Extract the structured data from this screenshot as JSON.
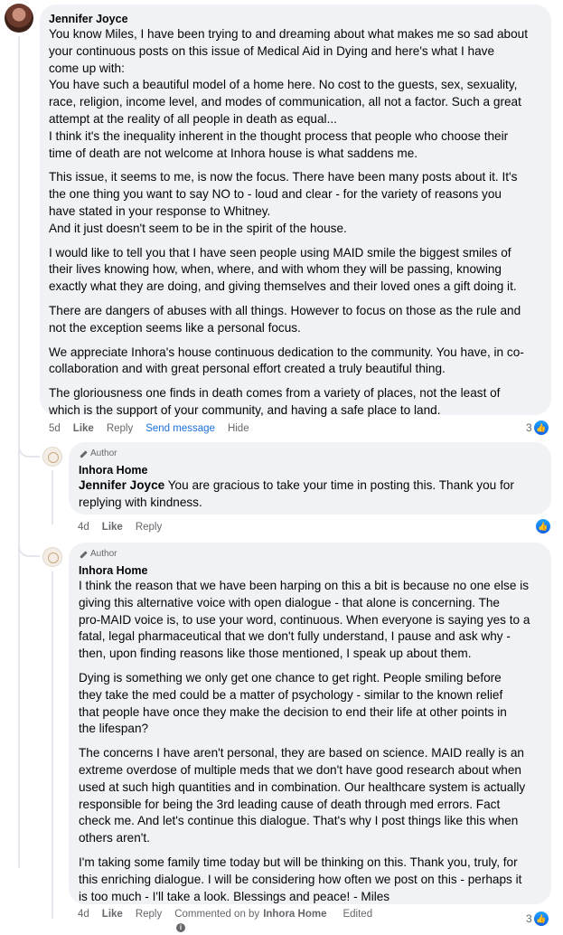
{
  "comment": {
    "author": "Jennifer Joyce",
    "paragraphs": [
      [
        "You know Miles, I have been trying to and dreaming about what makes me so sad about",
        "your continuous posts on this issue of Medical Aid in Dying and here's what I have",
        "come up with:",
        "You have such a beautiful model of a home here. No cost to the guests, sex, sexuality,",
        "race, religion, income level, and modes of communication, all not a factor. Such a great",
        "attempt at the reality of all people in death as equal...",
        "I think it's the inequality inherent in the thought process that people who choose their",
        "time of death are not welcome at Inhora house is what saddens me."
      ],
      [
        "This issue, it seems to me, is now the focus. There have been many posts about it. It's",
        "the one thing you want to say NO to - loud and clear - for the variety of reasons you",
        "have stated in your response to Whitney.",
        "And it just doesn't seem to be in the spirit of the house."
      ],
      [
        "I would like to tell you that I have seen people using MAID smile the biggest smiles of",
        "their lives knowing how, when, where, and with whom they will be passing, knowing",
        "exactly what they are doing, and giving themselves and their loved ones a gift doing it."
      ],
      [
        "There are dangers of abuses with all things. However to focus on those as the rule and",
        "not the exception seems like a personal focus."
      ],
      [
        "We appreciate Inhora's house continuous dedication to the community. You have, in co-",
        "collaboration and with great personal effort created a truly beautiful thing."
      ],
      [
        "The gloriousness one finds in death comes from a variety of places, not the least of",
        "which is the support of your community, and having a safe place to land."
      ]
    ],
    "actions": {
      "time": "5d",
      "like": "Like",
      "reply": "Reply",
      "send_message": "Send message",
      "hide": "Hide"
    },
    "reaction_count": "3"
  },
  "reply1": {
    "badge": "Author",
    "author": "Inhora Home",
    "mention": "Jennifer Joyce",
    "lines": [
      " You are gracious to take your time in posting this. Thank you for",
      "replying with kindness."
    ],
    "actions": {
      "time": "4d",
      "like": "Like",
      "reply": "Reply"
    }
  },
  "reply2": {
    "badge": "Author",
    "author": "Inhora Home",
    "paragraphs": [
      [
        "I think the reason that we have been harping on this a bit is because no one else is",
        "giving this alternative voice with open dialogue - that alone is concerning. The",
        "pro-MAID voice is, to use your word, continuous. When everyone is saying yes to a",
        "fatal, legal pharmaceutical that we don't fully understand, I pause and ask why -",
        "then, upon finding reasons like those mentioned, I speak up about them."
      ],
      [
        "Dying is something we only get one chance to get right. People smiling before",
        "they take the med could be a matter of psychology - similar to the known relief",
        "that people have once they make the decision to end their life at other points in",
        "the lifespan?"
      ],
      [
        "The concerns I have aren't personal, they are based on science. MAID really is an",
        "extreme overdose of multiple meds that we don't have good research about when",
        "used at such high quantities and in combination. Our healthcare system is actually",
        "responsible for being the 3rd leading cause of death through med errors. Fact",
        "check me. And let's continue this dialogue. That's why I post things like this when",
        "others aren't."
      ],
      [
        "I'm taking some family time today but will be thinking on this. Thank you, truly, for",
        "this enriching dialogue. I will be considering how often we post on this - perhaps it",
        "is too much - I'll take a look. Blessings and peace! - Miles"
      ]
    ],
    "actions": {
      "time": "4d",
      "like": "Like",
      "reply": "Reply",
      "commented_on_by": "Commented on by",
      "commented_by_name": "Inhora Home",
      "edited": "Edited"
    },
    "reaction_count": "3"
  },
  "colors": {
    "bubble": "#f0f2f5",
    "meta": "#65676b",
    "link": "#1b6fd8",
    "like": "#1877f2"
  }
}
